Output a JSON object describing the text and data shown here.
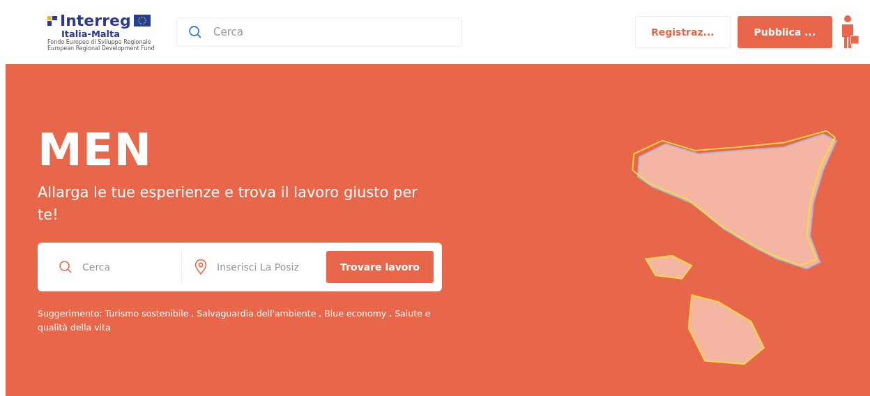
{
  "header": {
    "logo": {
      "title": "Interreg",
      "subtitle": "Italia-Malta",
      "lines": [
        "Fondo Europeo di Sviluppo Regionale",
        "European Regional Development Fund"
      ]
    },
    "search": {
      "placeholder": "Cerca"
    },
    "buttons": [
      {
        "label": "Registraz...",
        "kind": "outline"
      },
      {
        "label": "Pubblica ...",
        "kind": "filled"
      }
    ]
  },
  "hero": {
    "title": "MEN",
    "subtitle": "Allarga le tue esperienze e trova il lavoro giusto per te!",
    "search": {
      "keyword_placeholder": "Cerca",
      "location_placeholder": "Inserisci La Posiz",
      "button": "Trovare lavoro"
    },
    "suggestion": "Suggerimento: Turismo sostenibile , Salvaguardia dell'ambiente , Blue economy , Salute e qualità della vita"
  }
}
